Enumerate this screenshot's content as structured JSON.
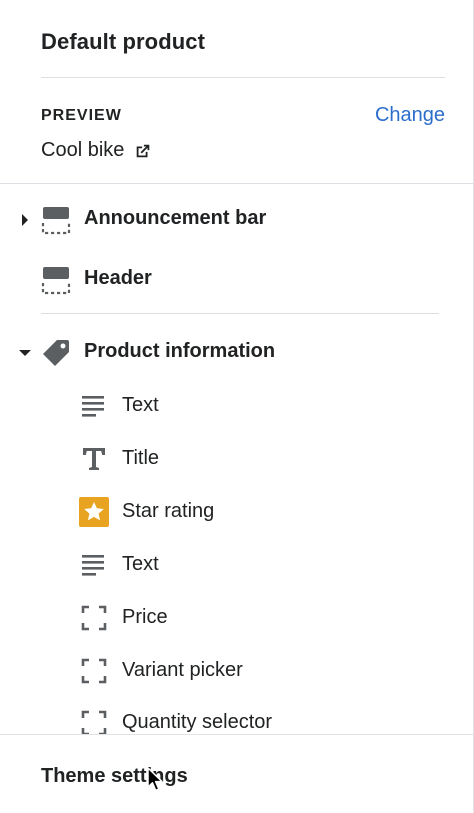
{
  "panel": {
    "title": "Default product",
    "preview": {
      "label": "PREVIEW",
      "change_label": "Change",
      "product_name": "Cool bike",
      "product_icon": "external-link-icon"
    }
  },
  "sections": {
    "announcement": {
      "label": "Announcement bar",
      "icon": "section-layout-icon",
      "expanded": false
    },
    "header": {
      "label": "Header",
      "icon": "section-layout-icon"
    },
    "product": {
      "label": "Product information",
      "icon": "tag-icon",
      "expanded": true,
      "blocks": [
        {
          "label": "Text",
          "icon": "text-lines-icon"
        },
        {
          "label": "Title",
          "icon": "title-t-icon"
        },
        {
          "label": "Star rating",
          "icon": "star-app-icon"
        },
        {
          "label": "Text",
          "icon": "text-lines-icon"
        },
        {
          "label": "Price",
          "icon": "dashed-square-icon"
        },
        {
          "label": "Variant picker",
          "icon": "dashed-square-icon"
        },
        {
          "label": "Quantity selector",
          "icon": "dashed-square-icon"
        }
      ]
    }
  },
  "footer": {
    "theme_settings_label": "Theme settings"
  },
  "colors": {
    "link": "#2c6ecb",
    "text": "#202223",
    "icon": "#5c5f62",
    "star_bg": "#e8a320",
    "divider": "#dcdfe3"
  }
}
